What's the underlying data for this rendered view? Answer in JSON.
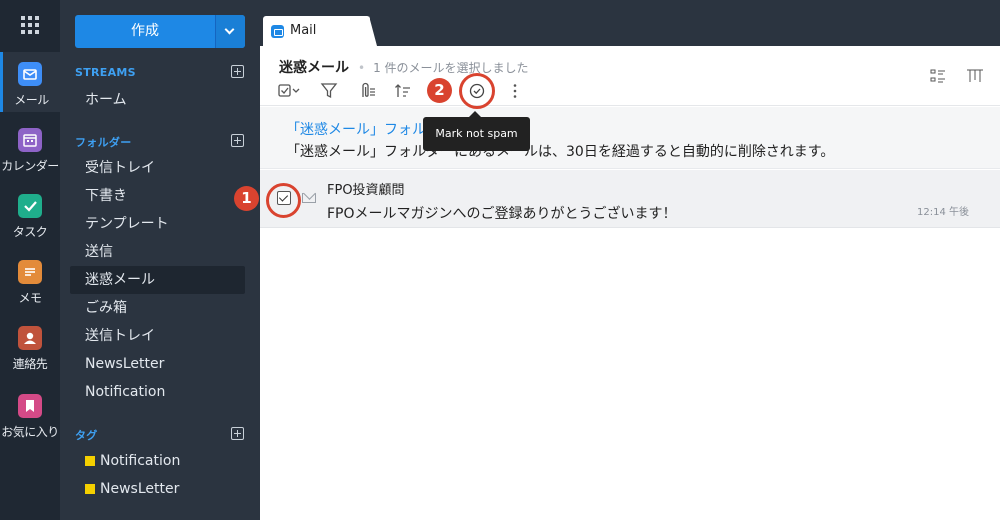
{
  "rail": {
    "items": [
      {
        "label": "メール",
        "icon": "mail-icon",
        "color": "#3e8ef7"
      },
      {
        "label": "カレンダー",
        "icon": "calendar-icon",
        "color": "#8e63c7"
      },
      {
        "label": "タスク",
        "icon": "task-icon",
        "color": "#1fae8c"
      },
      {
        "label": "メモ",
        "icon": "notes-icon",
        "color": "#e38b3a"
      },
      {
        "label": "連絡先",
        "icon": "contacts-icon",
        "color": "#c0533c"
      },
      {
        "label": "お気に入り",
        "icon": "bookmark-icon",
        "color": "#d44a87"
      }
    ]
  },
  "sidebar": {
    "compose_label": "作成",
    "streams_title": "STREAMS",
    "streams": [
      "ホーム"
    ],
    "folders_title": "フォルダー",
    "folders": [
      "受信トレイ",
      "下書き",
      "テンプレート",
      "送信",
      "迷惑メール",
      "ごみ箱",
      "送信トレイ",
      "NewsLetter",
      "Notification"
    ],
    "active_folder": "迷惑メール",
    "tags_title": "タグ",
    "tags": [
      {
        "label": "Notification",
        "color": "#f5d000"
      },
      {
        "label": "NewsLetter",
        "color": "#f5d000"
      }
    ]
  },
  "tab": {
    "label": "Mail"
  },
  "header": {
    "folder_title": "迷惑メール",
    "selection_status": "1 件のメールを選択しました"
  },
  "toolbar": {
    "tooltip": "Mark not spam"
  },
  "banner": {
    "link_text": "「迷惑メール」フォル",
    "text": "「迷惑メール」フォルダーにあるメールは、30日を経過すると自動的に削除されます。"
  },
  "message": {
    "from": "FPO投資顧問",
    "subject": "FPOメールマガジンへのご登録ありがとうございます！",
    "time": "12:14 午後",
    "selected": true
  },
  "callouts": {
    "step1": "1",
    "step2": "2"
  },
  "colors": {
    "accent": "#1e88e5",
    "callout": "#d9432f"
  }
}
